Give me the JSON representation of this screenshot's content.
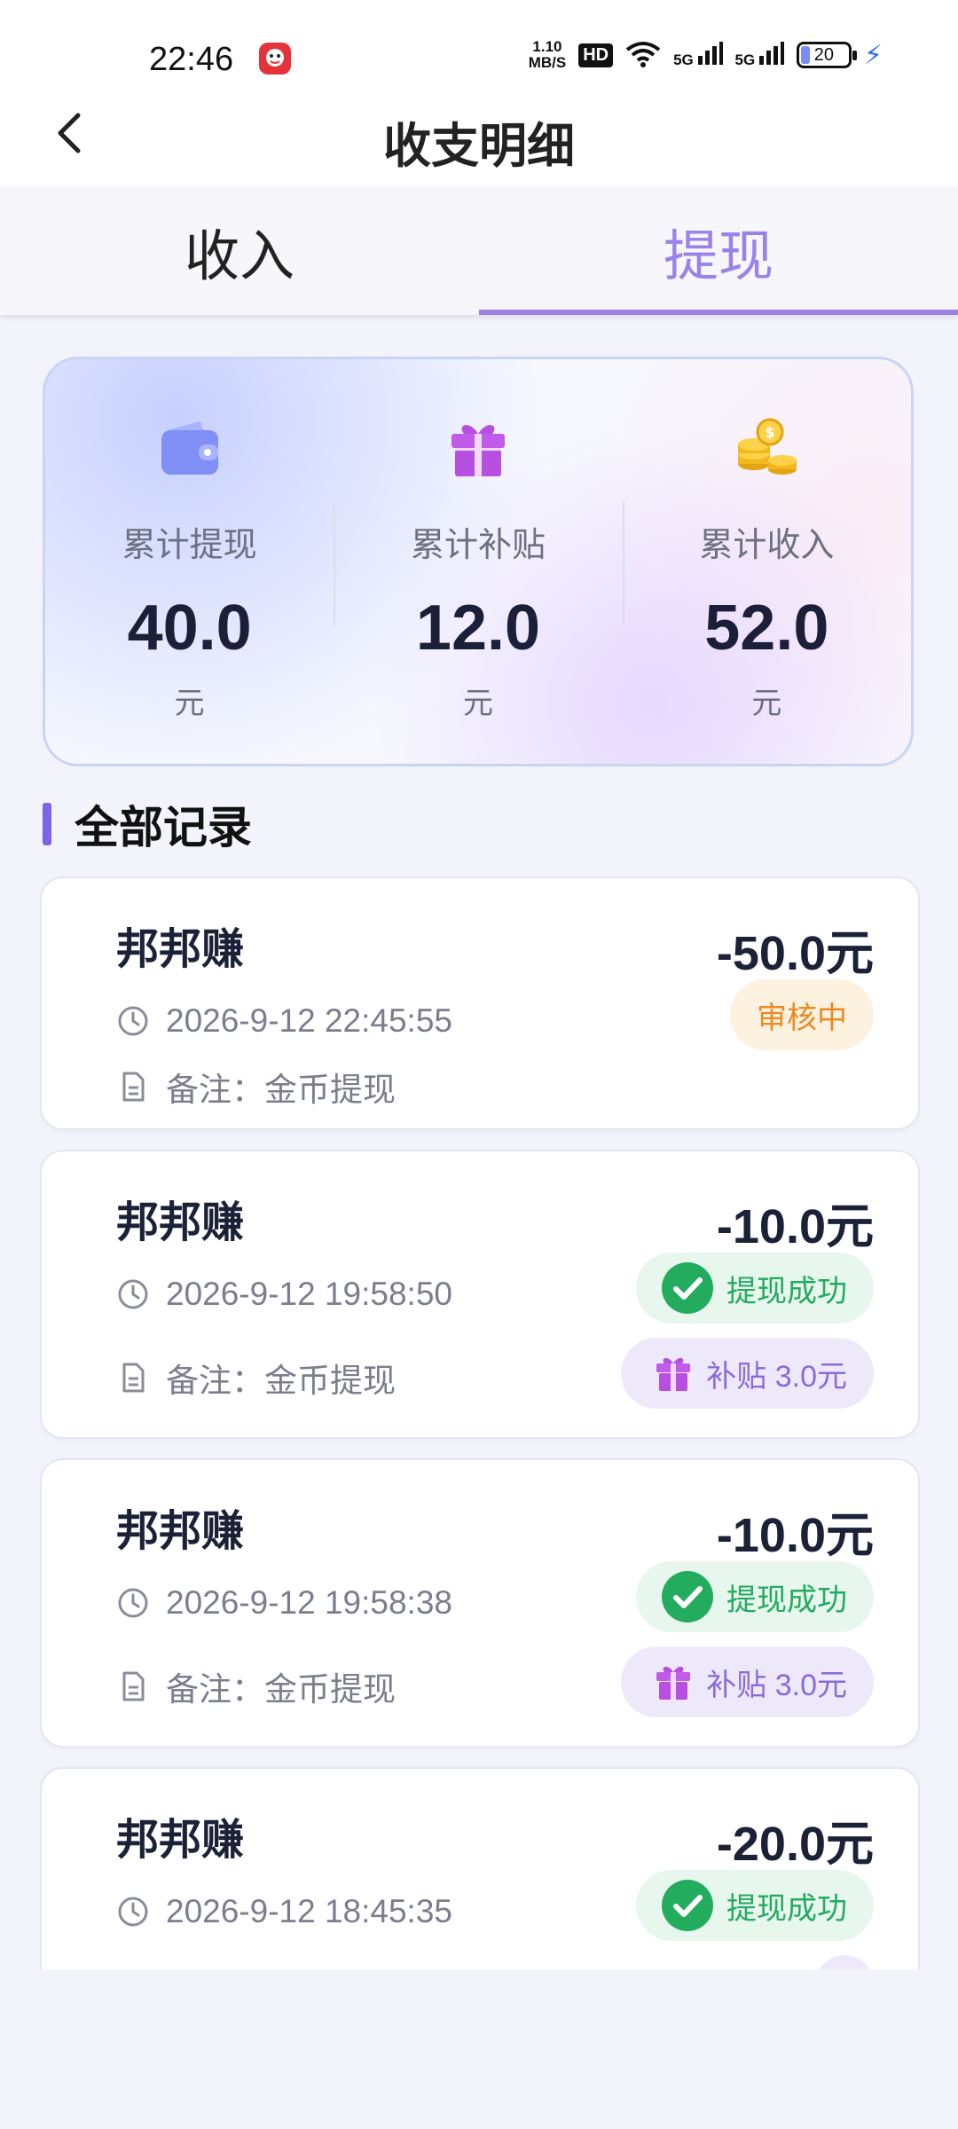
{
  "status_bar": {
    "time": "22:46",
    "speed_value": "1.10",
    "speed_unit": "MB/S",
    "hd": "HD",
    "net1": "5G",
    "net2": "5G",
    "battery": "20"
  },
  "header": {
    "title": "收支明细"
  },
  "tabs": [
    {
      "label": "收入",
      "active": false
    },
    {
      "label": "提现",
      "active": true
    }
  ],
  "summary": {
    "withdraw": {
      "label": "累计提现",
      "value": "40.0",
      "unit": "元",
      "icon": "wallet-icon"
    },
    "subsidy": {
      "label": "累计补贴",
      "value": "12.0",
      "unit": "元",
      "icon": "gift-icon"
    },
    "income": {
      "label": "累计收入",
      "value": "52.0",
      "unit": "元",
      "icon": "coins-icon"
    }
  },
  "section": {
    "title": "全部记录"
  },
  "records": [
    {
      "name": "邦邦赚",
      "amount": "-50.0元",
      "time": "2026-9-12 22:45:55",
      "note": "备注：金币提现",
      "status": "审核中"
    },
    {
      "name": "邦邦赚",
      "amount": "-10.0元",
      "time": "2026-9-12 19:58:50",
      "note": "备注：金币提现",
      "status": "提现成功",
      "subsidy": "补贴 3.0元"
    },
    {
      "name": "邦邦赚",
      "amount": "-10.0元",
      "time": "2026-9-12 19:58:38",
      "note": "备注：金币提现",
      "status": "提现成功",
      "subsidy": "补贴 3.0元"
    },
    {
      "name": "邦邦赚",
      "amount": "-20.0元",
      "time": "2026-9-12 18:45:35",
      "status": "提现成功"
    }
  ],
  "colors": {
    "accent": "#9b82e8",
    "section_bar": "#7d64e6",
    "review": "#ea8a22",
    "success": "#23ab5e",
    "subsidy": "#8a6bd8"
  }
}
